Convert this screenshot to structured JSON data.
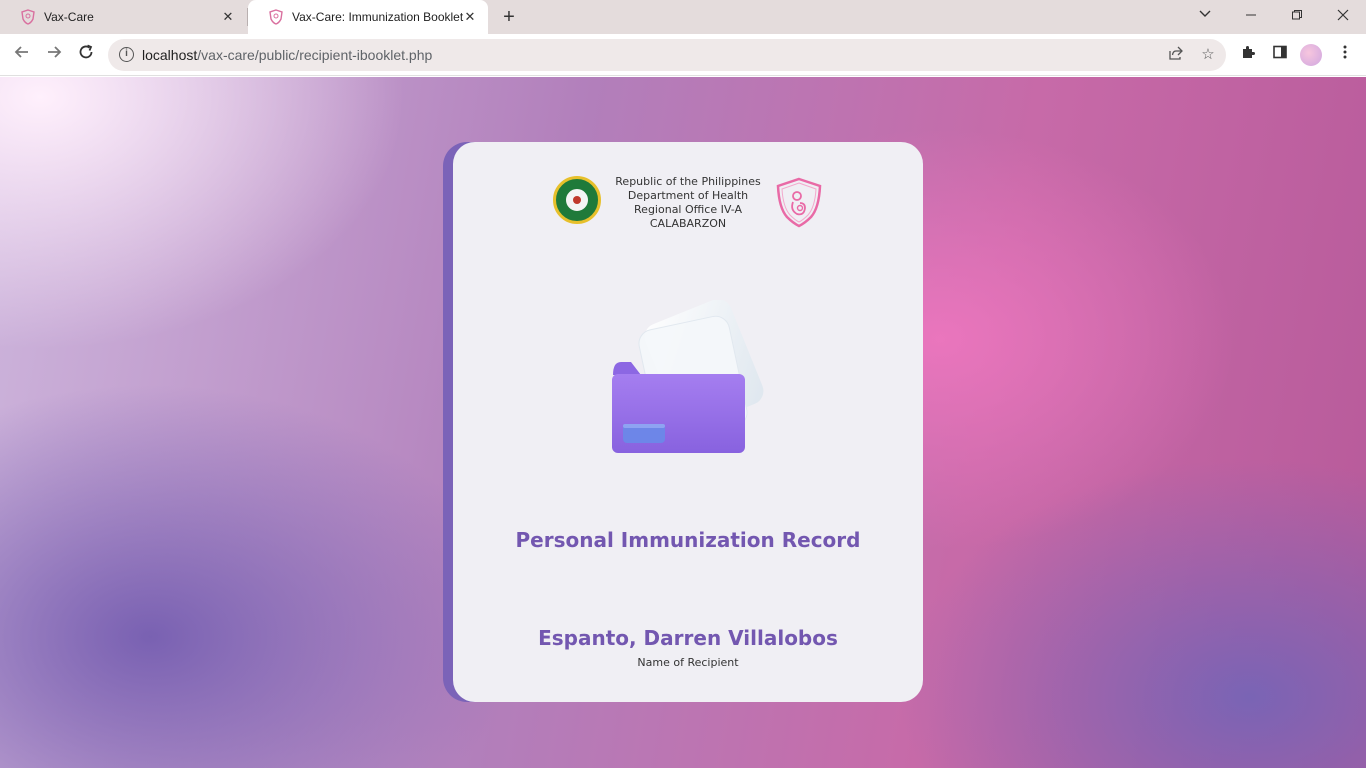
{
  "browser": {
    "tabs": [
      {
        "title": "Vax-Care",
        "active": false
      },
      {
        "title": "Vax-Care: Immunization Booklet",
        "active": true
      }
    ],
    "new_tab_symbol": "+",
    "address_bar": {
      "host": "localhost",
      "path": "/vax-care/public/recipient-ibooklet.php"
    }
  },
  "booklet": {
    "header_lines": [
      "Republic of the Philippines",
      "Department of Health",
      "Regional Office IV-A",
      "CALABARZON"
    ],
    "title": "Personal Immunization Record",
    "recipient_name": "Espanto, Darren Villalobos",
    "recipient_label": "Name of Recipient"
  },
  "colors": {
    "accent": "#7357b0",
    "booklet_spine": "#7b63b8",
    "page_bg": "#f0eff4",
    "logo_pink": "#e96aa6",
    "folder_purple": "#9b78e6"
  },
  "icons": {
    "tab_favicon": "vax-care-shield-icon",
    "doh_seal": "doh-seal-logo",
    "vax_logo": "vax-care-shield-logo",
    "illustration": "folder-icon"
  }
}
